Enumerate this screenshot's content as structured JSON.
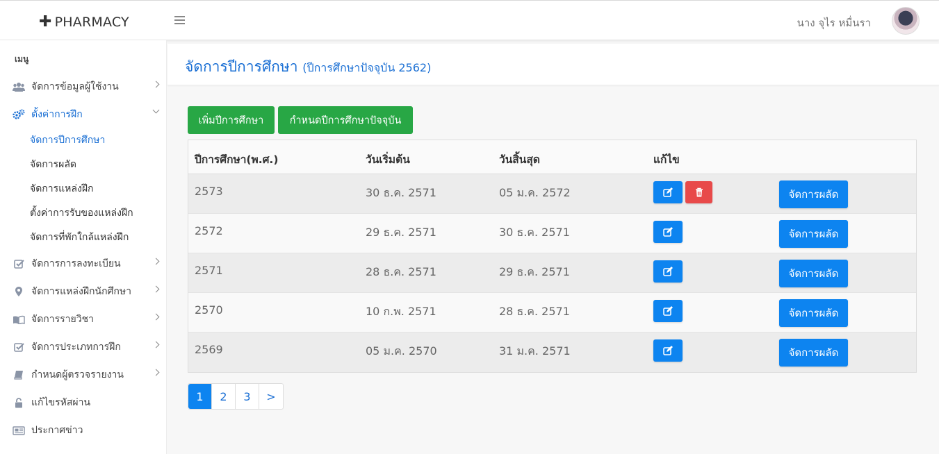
{
  "header": {
    "brand": "PHARMACY",
    "brand_icon": "plus-icon",
    "username": "นาง จุไร หมื่นรา"
  },
  "sidebar": {
    "caption": "เมนู",
    "items": [
      {
        "label": "จัดการข้อมูลผู้ใช้งาน",
        "icon": "users-icon"
      },
      {
        "label": "ตั้งค่าการฝึก",
        "icon": "gears-icon"
      },
      {
        "label": "จัดการการลงทะเบียน",
        "icon": "check-square-icon"
      },
      {
        "label": "จัดการแหล่งฝึกนักศึกษา",
        "icon": "map-marker-icon"
      },
      {
        "label": "จัดการรายวิชา",
        "icon": "book-open-icon"
      },
      {
        "label": "จัดการประเภทการฝึก",
        "icon": "check-square-icon"
      },
      {
        "label": "กำหนดผู้ตรวจรายงาน",
        "icon": "book-icon"
      },
      {
        "label": "แก้ไขรหัสผ่าน",
        "icon": "unlock-icon"
      },
      {
        "label": "ประกาศข่าว",
        "icon": "newspaper-icon"
      }
    ],
    "subitems": [
      {
        "label": "จัดการปีการศึกษา"
      },
      {
        "label": "จัดการผลัด"
      },
      {
        "label": "จัดการแหล่งฝึก"
      },
      {
        "label": "ตั้งค่าการรับของแหล่งฝึก"
      },
      {
        "label": "จัดการที่พักใกล้แหล่งฝึก"
      }
    ]
  },
  "content": {
    "title": "จัดการปีการศึกษา",
    "subtitle": "(ปีการศึกษาปัจจุบัน 2562)",
    "add_button": "เพิ่มปีการศึกษา",
    "set_current_button": "กำหนดปีการศึกษาปัจจุบัน"
  },
  "table": {
    "headers": [
      "ปีการศึกษา(พ.ศ.)",
      "วันเริ่มต้น",
      "วันสิ้นสุด",
      "แก้ไข"
    ],
    "manage_label": "จัดการผลัด",
    "rows": [
      {
        "year": "2573",
        "start": "30 ธ.ค. 2571",
        "end": "05 ม.ค. 2572"
      },
      {
        "year": "2572",
        "start": "29 ธ.ค. 2571",
        "end": "30 ธ.ค. 2571"
      },
      {
        "year": "2571",
        "start": "28 ธ.ค. 2571",
        "end": "29 ธ.ค. 2571"
      },
      {
        "year": "2570",
        "start": "10 ก.พ. 2571",
        "end": "28 ธ.ค. 2571"
      },
      {
        "year": "2569",
        "start": "05 ม.ค. 2570",
        "end": "31 ม.ค. 2571"
      }
    ]
  },
  "pagination": {
    "pages": [
      "1",
      "2",
      "3",
      ">"
    ],
    "current": "1"
  },
  "colors": {
    "primary": "#0d84f0",
    "success": "#28a745",
    "danger": "#e84a4a",
    "link": "#1a6fd4"
  }
}
